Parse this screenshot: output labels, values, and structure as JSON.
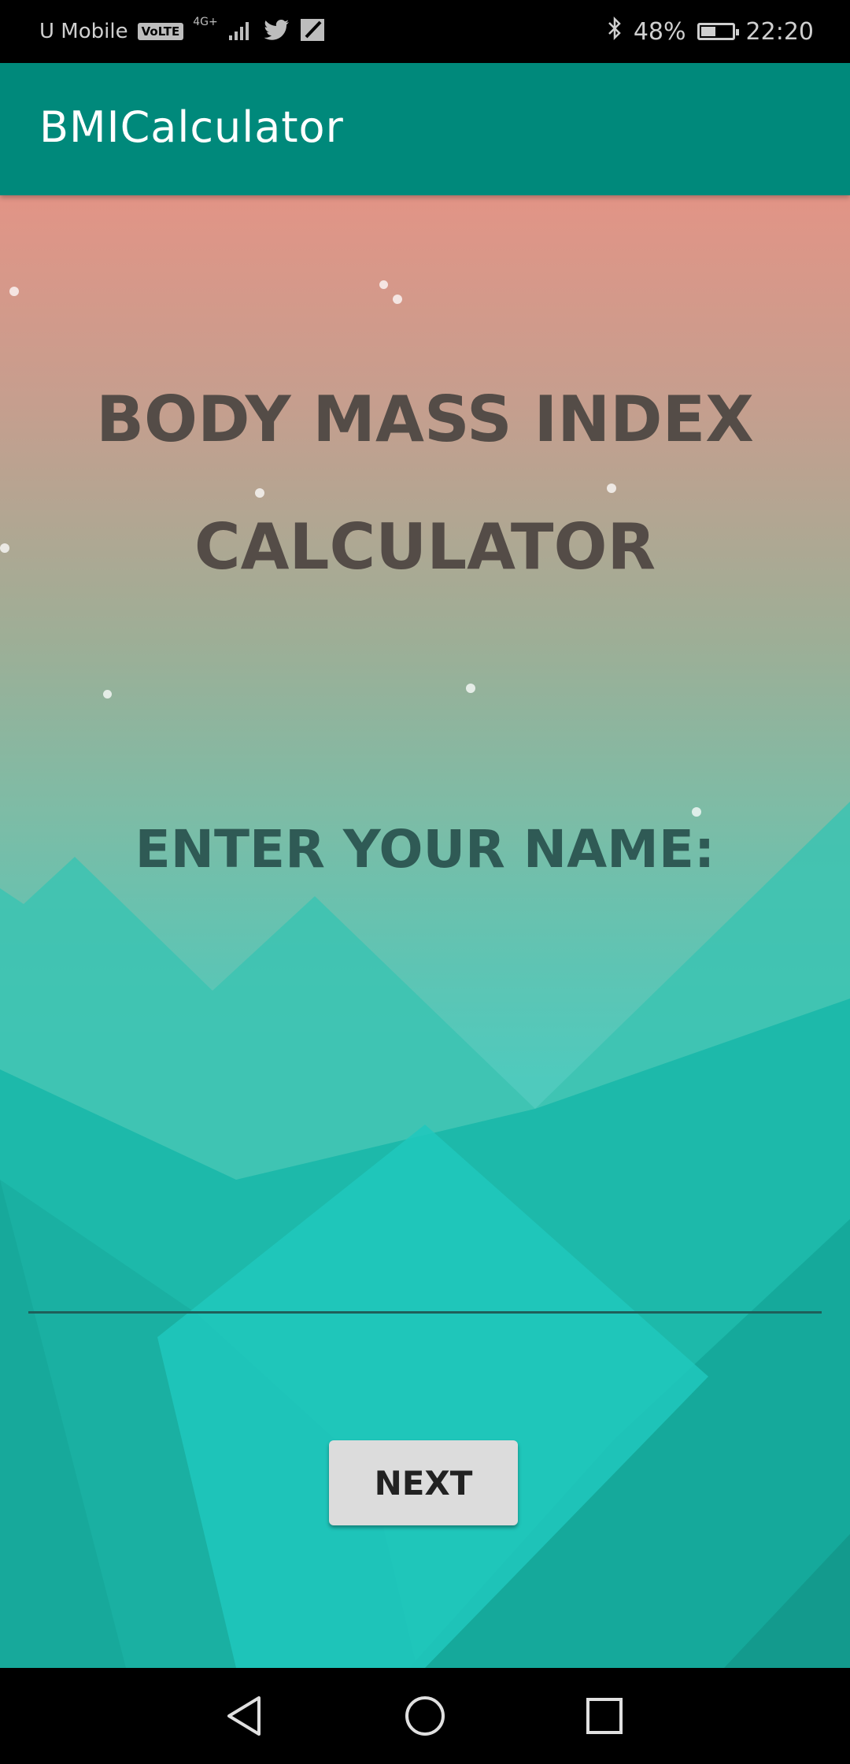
{
  "status_bar": {
    "carrier": "U Mobile",
    "volte": "VoLTE",
    "network": "4G+",
    "battery": "48%",
    "battery_level": 0.48,
    "time": "22:20"
  },
  "app_bar": {
    "title": "BMICalculator"
  },
  "main": {
    "title_line1": "BODY MASS INDEX",
    "title_line2": "CALCULATOR",
    "prompt": "ENTER YOUR NAME:",
    "name_value": "",
    "next_label": "NEXT"
  },
  "colors": {
    "app_bar": "#00897b",
    "gradient_top": "#e29486",
    "teal": "#1fc3b6",
    "title_text": "#544c47",
    "prompt_text": "#2f5a55"
  },
  "icons": {
    "bluetooth": "bluetooth-icon",
    "battery": "battery-icon",
    "signal": "signal-icon",
    "twitter": "twitter-icon",
    "notification": "notification-icon",
    "back": "back-icon",
    "home": "home-icon",
    "recents": "recents-icon"
  }
}
